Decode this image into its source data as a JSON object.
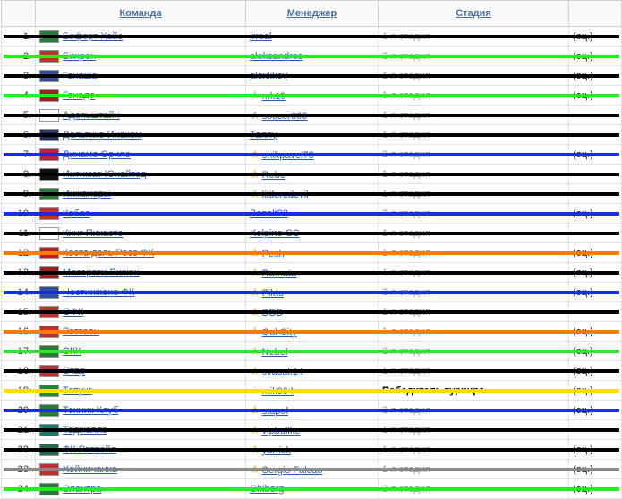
{
  "headers": {
    "team": "Команда",
    "manager": "Менеджер",
    "stage": "Стадия"
  },
  "rows": [
    {
      "n": "1.",
      "team": "Бофорт Хэйс",
      "flag": "#2a7a3a",
      "mgr": "irreal",
      "star": "",
      "stage": "1-я стадия",
      "oc": "(оц.)"
    },
    {
      "n": "2.",
      "team": "Бихрен",
      "flag": "#c03030",
      "mgr": "aleksandros",
      "star": "",
      "stage": "2-я стадия",
      "oc": "(оц.)"
    },
    {
      "n": "3.",
      "team": "Генаша",
      "flag": "#3050a0",
      "mgr": "alexlikov",
      "star": "",
      "stage": "1-я стадия",
      "oc": "(оц.)"
    },
    {
      "n": "4.",
      "team": "Гонадо",
      "flag": "#a02020",
      "mgr": "mk19",
      "star": "gold",
      "stage": "1-я стадия",
      "oc": "(оц.)"
    },
    {
      "n": "5.",
      "team": "Адельштайн",
      "flag": "#ffffff",
      "mgr": "soccer666",
      "star": "gray",
      "stage": "1-я стадия",
      "oc": ""
    },
    {
      "n": "6.",
      "team": "Дельтико Инаком",
      "flag": "#203060",
      "mgr": "Таллу",
      "star": "",
      "stage": "1-я стадия",
      "oc": ""
    },
    {
      "n": "7.",
      "team": "Динамо Ориле",
      "flag": "#c02040",
      "mgr": "shikpavel78",
      "star": "gold",
      "stage": "2-я стадия",
      "oc": "(оц.)"
    },
    {
      "n": "8.",
      "team": "Интимат Юнайтед",
      "flag": "#101010",
      "mgr": "Rebe",
      "star": "gold",
      "stage": "1-я стадия",
      "oc": ""
    },
    {
      "n": "9.",
      "team": "Инжанеры",
      "flag": "#2a7a3a",
      "mgr": "littleredevil",
      "star": "gold",
      "stage": "1-я стадия",
      "oc": ""
    },
    {
      "n": "10.",
      "team": "Кобао",
      "flag": "#c03030",
      "mgr": "Bazalt98",
      "star": "",
      "stage": "2-я стадия",
      "oc": "(оц.)"
    },
    {
      "n": "11.",
      "team": "Кинг Пикасто",
      "flag": "#ffffff",
      "mgr": "Kolpino-SC",
      "star": "",
      "stage": "1-я стадия",
      "oc": ""
    },
    {
      "n": "12.",
      "team": "Коста дель Росо ФК",
      "flag": "#c02020",
      "mgr": "Pesh",
      "star": "gold",
      "stage": "1-я стадия",
      "oc": "(оц.)"
    },
    {
      "n": "13.",
      "team": "Мазерати Вижен",
      "flag": "#a02020",
      "mgr": "Ramata",
      "star": "gold",
      "stage": "1-я стадия",
      "oc": "(оц.)"
    },
    {
      "n": "14.",
      "team": "Нестинжене ФК",
      "flag": "#3050a0",
      "mgr": "Pikto",
      "star": "gold",
      "stage": "2-я стадия",
      "oc": "(оц.)"
    },
    {
      "n": "15.",
      "team": "ОФК",
      "flag": "#c03030",
      "mgr": "DDD",
      "star": "gold",
      "stage": "1-я стадия",
      "oc": ""
    },
    {
      "n": "16.",
      "team": "Роттаон",
      "flag": "#c03030",
      "mgr": "Oul City",
      "star": "gold",
      "stage": "1-я стадия",
      "oc": "(оц.)"
    },
    {
      "n": "17.",
      "team": "СКК",
      "flag": "#2a7a3a",
      "mgr": "Nebel",
      "star": "gold",
      "stage": "2-я стадия",
      "oc": "(оц.)"
    },
    {
      "n": "18.",
      "team": "Стар",
      "flag": "#c03030",
      "mgr": "svasuk14",
      "star": "gold",
      "stage": "1-я стадия",
      "oc": "(оц.)"
    },
    {
      "n": "19.",
      "team": "Татунг",
      "flag": "#1a8a3a",
      "mgr": "mik994",
      "star": "outline",
      "stage": "Победитель турнира",
      "oc": "(оц.)",
      "winner": true
    },
    {
      "n": "20.",
      "team": "Техник Клуб",
      "flag": "#2a7a3a",
      "mgr": "stapol",
      "star": "gold",
      "stage": "2-я стадия",
      "oc": "(оц.)"
    },
    {
      "n": "21.",
      "team": "Тоджеллэ",
      "flag": "#1a7a6a",
      "mgr": "vipbullke",
      "star": "gold",
      "stage": "1-я стадия",
      "oc": ""
    },
    {
      "n": "22.",
      "team": "ФК Ротвейл",
      "flag": "#2a6a4a",
      "mgr": "yurrick",
      "star": "gold",
      "stage": "1-я стадия",
      "oc": "(оц.)"
    },
    {
      "n": "23.",
      "team": "Хойничанка",
      "flag": "#c03030",
      "mgr": "Sergio Falcao",
      "star": "gold",
      "stage": "1-я стадия",
      "oc": "(оц.)"
    },
    {
      "n": "24.",
      "team": "Элантра",
      "flag": "#2a7a3a",
      "mgr": "Chiborg",
      "star": "",
      "stage": "2-я стадия",
      "oc": "(оц.)"
    }
  ],
  "strike_colors": {
    "black": "#000000",
    "green": "#22ee22",
    "blue": "#1a2aee",
    "orange": "#ff7a00",
    "yellow": "#ffdd00",
    "gray": "#888888"
  },
  "strikes": [
    "black",
    "green",
    "black",
    "green",
    "black",
    "black",
    "blue",
    "black",
    "black",
    "blue",
    "black",
    "orange",
    "black",
    "blue",
    "black",
    "orange",
    "green",
    "black",
    "yellow",
    "blue",
    "black",
    "black",
    "gray",
    "green"
  ]
}
